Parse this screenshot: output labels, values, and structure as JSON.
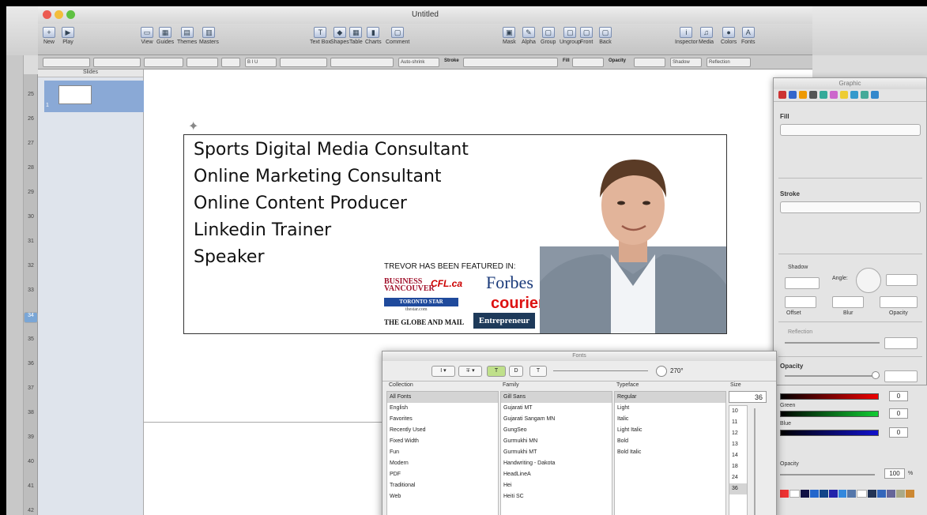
{
  "window": {
    "title": "Untitled"
  },
  "toolbar": {
    "items": [
      {
        "label": "New",
        "glyph": "+"
      },
      {
        "label": "Play",
        "glyph": "▶"
      },
      {
        "label": "View",
        "glyph": "▭"
      },
      {
        "label": "Guides",
        "glyph": "▦"
      },
      {
        "label": "Themes",
        "glyph": "▤"
      },
      {
        "label": "Masters",
        "glyph": "▥"
      },
      {
        "label": "Text Box",
        "glyph": "T"
      },
      {
        "label": "Shapes",
        "glyph": "◆"
      },
      {
        "label": "Table",
        "glyph": "▦"
      },
      {
        "label": "Charts",
        "glyph": "▮"
      },
      {
        "label": "Comment",
        "glyph": "▢"
      },
      {
        "label": "Mask",
        "glyph": "▣"
      },
      {
        "label": "Alpha",
        "glyph": "✎"
      },
      {
        "label": "Group",
        "glyph": "▢"
      },
      {
        "label": "Ungroup",
        "glyph": "▢"
      },
      {
        "label": "Front",
        "glyph": "▢"
      },
      {
        "label": "Back",
        "glyph": "▢"
      },
      {
        "label": "Inspector",
        "glyph": "i"
      },
      {
        "label": "Media",
        "glyph": "♫"
      },
      {
        "label": "Colors",
        "glyph": "●"
      },
      {
        "label": "Fonts",
        "glyph": "A"
      }
    ]
  },
  "formatbar": {
    "autoshrink": "Auto-shrink",
    "stroke": "Stroke",
    "fill": "Fill",
    "opacity": "Opacity",
    "shadow": "Shadow",
    "reflection": "Reflection"
  },
  "navigator": {
    "header": "Slides",
    "slide_number": "1"
  },
  "ruler": {
    "numbers": [
      "25",
      "26",
      "27",
      "28",
      "29",
      "30",
      "31",
      "32",
      "33",
      "34",
      "35",
      "36",
      "37",
      "38",
      "39",
      "40",
      "41",
      "42"
    ],
    "selected": "34"
  },
  "slide": {
    "lines": [
      "Sports Digital Media Consultant",
      "Online Marketing Consultant",
      "Online Content Producer",
      "Linkedin Trainer",
      "Speaker"
    ],
    "featured_heading": "TREVOR HAS BEEN FEATURED IN:",
    "logos": {
      "bv": "BUSINESS VANCOUVER",
      "cfl": "CFL.ca",
      "forbes": "Forbes",
      "star": "TORONTO STAR",
      "star_sub": "thestar.com",
      "courier": "courier",
      "globe": "THE GLOBE AND MAIL",
      "entre": "Entrepreneur"
    }
  },
  "inspector": {
    "title": "Graphic",
    "fill": "Fill",
    "stroke": "Stroke",
    "shadow": "Shadow",
    "angle": "Angle:",
    "offset": "Offset",
    "blur": "Blur",
    "opacity_small": "Opacity",
    "reflection": "Reflection",
    "opacity": "Opacity"
  },
  "colors_panel": {
    "red_value": "0",
    "green_label": "Green",
    "green_value": "0",
    "blue_label": "Blue",
    "blue_value": "0",
    "opacity_label": "Opacity",
    "opacity_value": "100",
    "percent": "%"
  },
  "fonts_panel": {
    "title": "Fonts",
    "rotation": "270°",
    "headers": {
      "collection": "Collection",
      "family": "Family",
      "typeface": "Typeface",
      "size": "Size"
    },
    "size_value": "36",
    "collections": [
      "All Fonts",
      "English",
      "Favorites",
      "Recently Used",
      "Fixed Width",
      "Fun",
      "Modern",
      "PDF",
      "Traditional",
      "Web"
    ],
    "families": [
      "Gill Sans",
      "Gujarati MT",
      "Gujarati Sangam MN",
      "GungSeo",
      "Gurmukhi MN",
      "Gurmukhi MT",
      "Handwriting - Dakota",
      "HeadLineA",
      "Hei",
      "Heiti SC"
    ],
    "typefaces": [
      "Regular",
      "Light",
      "Italic",
      "Light Italic",
      "Bold",
      "Bold Italic"
    ],
    "sizes": [
      "10",
      "11",
      "12",
      "13",
      "14",
      "18",
      "24",
      "36"
    ]
  }
}
